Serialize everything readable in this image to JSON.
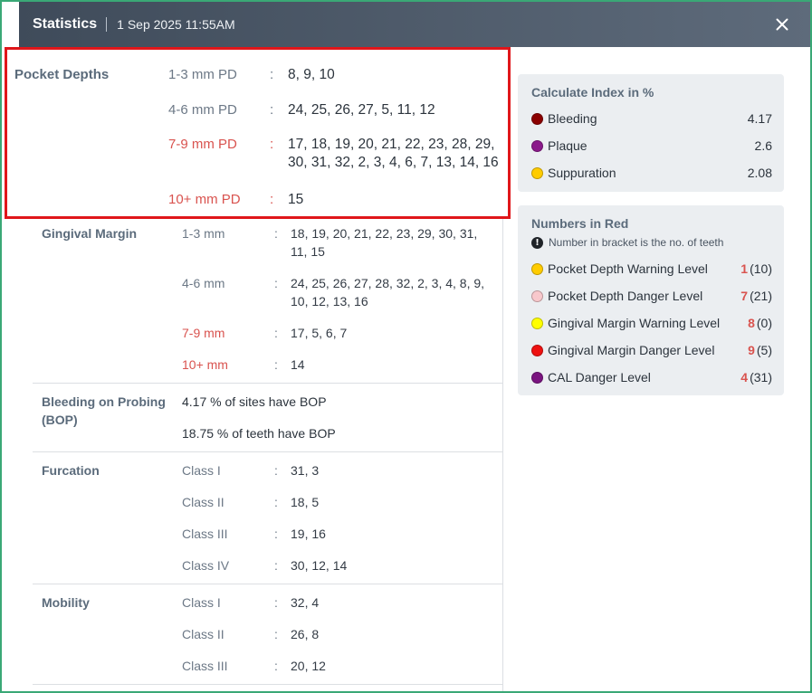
{
  "header": {
    "title": "Statistics",
    "datetime": "1 Sep 2025 11:55AM",
    "close_icon": "close-icon"
  },
  "pocket_depths": {
    "label": "Pocket Depths",
    "rows": [
      {
        "label": "1-3 mm PD",
        "value": "8, 9, 10",
        "color": "#6c7886"
      },
      {
        "label": "4-6 mm PD",
        "value": "24, 25, 26, 27, 5, 11, 12",
        "color": "#6c7886"
      },
      {
        "label": "7-9 mm PD",
        "value": "17, 18, 19, 20, 21, 22, 23, 28, 29, 30, 31, 32, 2, 3, 4, 6, 7, 13, 14, 16",
        "color": "#d9534f"
      },
      {
        "label": "10+ mm PD",
        "value": "15",
        "color": "#d9534f"
      }
    ]
  },
  "gingival_margin": {
    "label": "Gingival Margin",
    "rows": [
      {
        "label": "1-3 mm",
        "value": "18, 19, 20, 21, 22, 23, 29, 30, 31, 11, 15"
      },
      {
        "label": "4-6 mm",
        "value": "24, 25, 26, 27, 28, 32, 2, 3, 4, 8, 9, 10, 12, 13, 16"
      },
      {
        "label": "7-9 mm",
        "value": "17, 5, 6, 7"
      },
      {
        "label": "10+ mm",
        "value": "14"
      }
    ]
  },
  "bop": {
    "label": "Bleeding on Probing (BOP)",
    "sites": "4.17 % of sites have BOP",
    "teeth": "18.75 % of teeth have BOP"
  },
  "furcation": {
    "label": "Furcation",
    "rows": [
      {
        "label": "Class I",
        "value": "31, 3"
      },
      {
        "label": "Class II",
        "value": "18, 5"
      },
      {
        "label": "Class III",
        "value": "19, 16"
      },
      {
        "label": "Class IV",
        "value": "30, 12, 14"
      }
    ]
  },
  "mobility": {
    "label": "Mobility",
    "rows": [
      {
        "label": "Class I",
        "value": "32, 4"
      },
      {
        "label": "Class II",
        "value": "26, 8"
      },
      {
        "label": "Class III",
        "value": "20, 12"
      }
    ]
  },
  "colon": ":",
  "index_card": {
    "title": "Calculate Index in %",
    "items": [
      {
        "label": "Bleeding",
        "value": "4.17",
        "color": "#8b0000"
      },
      {
        "label": "Plaque",
        "value": "2.6",
        "color": "#8b1a8b"
      },
      {
        "label": "Suppuration",
        "value": "2.08",
        "color": "#ffcc00"
      }
    ]
  },
  "red_card": {
    "title": "Numbers in Red",
    "note": "Number in bracket is the no. of teeth",
    "note_icon": "exclamation-icon",
    "items": [
      {
        "label": "Pocket Depth Warning Level",
        "num": "1",
        "count": "(10)",
        "color": "#ffcc00"
      },
      {
        "label": "Pocket Depth Danger Level",
        "num": "7",
        "count": "(21)",
        "color": "#f8c8cc"
      },
      {
        "label": "Gingival Margin Warning Level",
        "num": "8",
        "count": "(0)",
        "color": "#ffff00"
      },
      {
        "label": "Gingival Margin Danger Level",
        "num": "9",
        "count": "(5)",
        "color": "#ee1111"
      },
      {
        "label": "CAL Danger Level",
        "num": "4",
        "count": "(31)",
        "color": "#7a1480"
      }
    ]
  }
}
